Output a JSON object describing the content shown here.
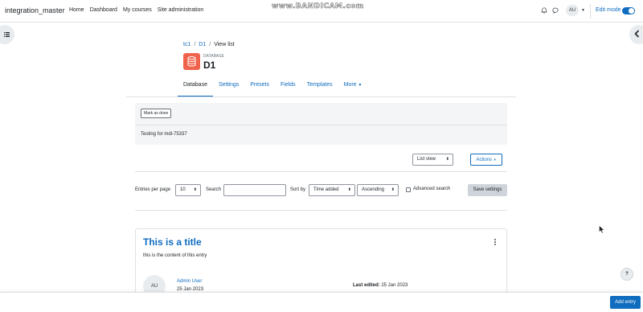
{
  "navbar": {
    "site_name": "integration_master",
    "items": [
      "Home",
      "Dashboard",
      "My courses",
      "Site administration"
    ],
    "watermark": "www.BANDICAM.com",
    "avatar_initials": "AU",
    "edit_mode_label": "Edit mode"
  },
  "breadcrumb": {
    "items": [
      "tc1",
      "D1",
      "View list"
    ]
  },
  "page_header": {
    "type_label": "DATABASE",
    "title": "D1"
  },
  "secondary_nav": {
    "tabs": [
      "Database",
      "Settings",
      "Presets",
      "Fields",
      "Templates",
      "More"
    ]
  },
  "activity_header": {
    "mark_done_label": "Mark as done",
    "intro": "Testing for mdl-75337"
  },
  "view_controls": {
    "view_select": "List view",
    "actions_label": "Actions"
  },
  "filters": {
    "entries_per_page_label": "Entries per page",
    "entries_per_page_value": "10",
    "search_label": "Search",
    "search_value": "",
    "sort_by_label": "Sort by",
    "sort_field": "Time added",
    "sort_order": "Ascending",
    "advanced_search_label": "Advanced search",
    "advanced_search_checked": false,
    "save_settings_label": "Save settings"
  },
  "entry": {
    "title": "This is a title",
    "content": "this is the content of this entry",
    "author_initials": "AU",
    "author": "Admin User",
    "date": "25 Jan 2023",
    "last_edited_label": "Last edited:",
    "last_edited_value": "25 Jan 2023"
  },
  "footer": {
    "add_entry_label": "Add entry",
    "help_label": "?"
  },
  "colors": {
    "primary": "#0f6cbf",
    "db_icon": "#f0624b"
  },
  "icons": [
    "bell-icon",
    "chat-icon",
    "toggle-switch",
    "drawer-index-icon",
    "chevron-left-icon",
    "database-icon",
    "kebab-menu-icon",
    "question-icon",
    "cursor-icon"
  ]
}
